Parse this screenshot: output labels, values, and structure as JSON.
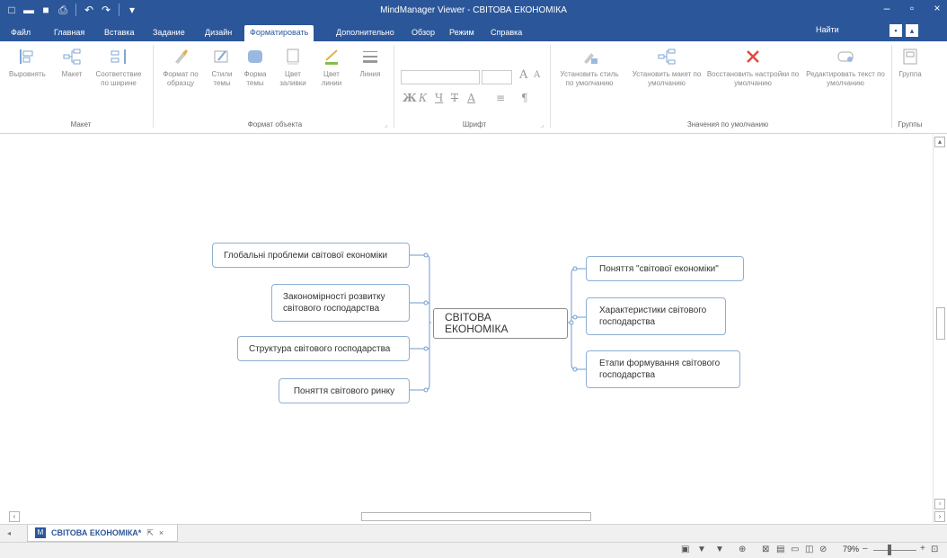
{
  "window": {
    "title": "MindManager Viewer - СВІТОВА ЕКОНОМІКА"
  },
  "ribbon_tabs": [
    "Файл",
    "Главная",
    "Вставка",
    "Задание",
    "Дизайн",
    "Форматировать",
    "Дополнительно",
    "Обзор",
    "Режим",
    "Справка"
  ],
  "active_tab": "Форматировать",
  "find_label": "Найти",
  "ribbon": {
    "layout": {
      "align_label": "Выровнять",
      "layout_label": "Макет",
      "fit_width_label": "Соответствие по ширине",
      "group": "Макет"
    },
    "object_format": {
      "format_painter_label": "Формат по образцу",
      "theme_styles_label": "Стили темы",
      "theme_shape_label": "Форма темы",
      "fill_color_label": "Цвет заливки",
      "line_color_label": "Цвет линии",
      "line_label": "Линия",
      "group": "Формат объекта"
    },
    "font": {
      "grow_label": "A",
      "shrink_label": "A",
      "bold_label": "Ж",
      "italic_label": "К",
      "underline_label": "Ч",
      "strike_label": "Т",
      "color_label": "А",
      "group": "Шрифт"
    },
    "defaults": {
      "set_style_label": "Установить стиль по умолчанию",
      "set_layout_label": "Установить макет по умолчанию",
      "reset_label": "Восстановить настройки по умолчанию",
      "edit_text_label": "Редактировать текст по умолчанию",
      "group": "Значения по умолчанию"
    },
    "groups": {
      "group_label": "Группа",
      "group": "Группы"
    }
  },
  "mindmap": {
    "central": "СВІТОВА ЕКОНОМІКА",
    "left": [
      "Глобальні проблеми світової економіки",
      "Закономірності розвитку світового господарства",
      "Структура світового господарства",
      "Поняття світового ринку"
    ],
    "right": [
      "Поняття \"світової економіки\"",
      "Характеристики світового господарства",
      "Етапи формування світового господарства"
    ]
  },
  "document_tab": {
    "name": "СВІТОВА ЕКОНОМІКА*",
    "close": "×"
  },
  "status": {
    "zoom": "79%"
  },
  "colors": {
    "accent": "#2b579a",
    "topic_border": "#8db0d4",
    "connector": "#6f9bd1",
    "reset_red": "#e0493f"
  }
}
